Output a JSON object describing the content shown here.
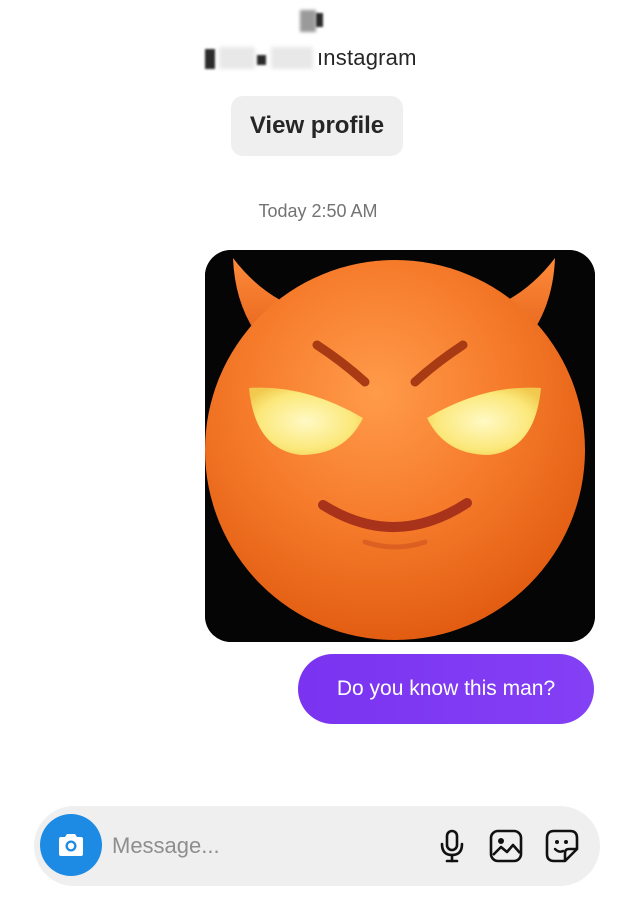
{
  "header": {
    "handle_suffix": "ınstagram"
  },
  "view_profile_label": "View profile",
  "timestamp": "Today 2:50 AM",
  "messages": [
    {
      "type": "image",
      "content": "devil-emoji-image"
    },
    {
      "type": "text",
      "text": "Do you know this man?"
    }
  ],
  "composer": {
    "placeholder": "Message...",
    "icons": [
      "camera-icon",
      "microphone-icon",
      "gallery-icon",
      "sticker-icon"
    ]
  },
  "colors": {
    "bubble": "#7b3cf2",
    "camera_button": "#1d8be3",
    "composer_bg": "#efefef",
    "view_profile_bg": "#efefef"
  }
}
